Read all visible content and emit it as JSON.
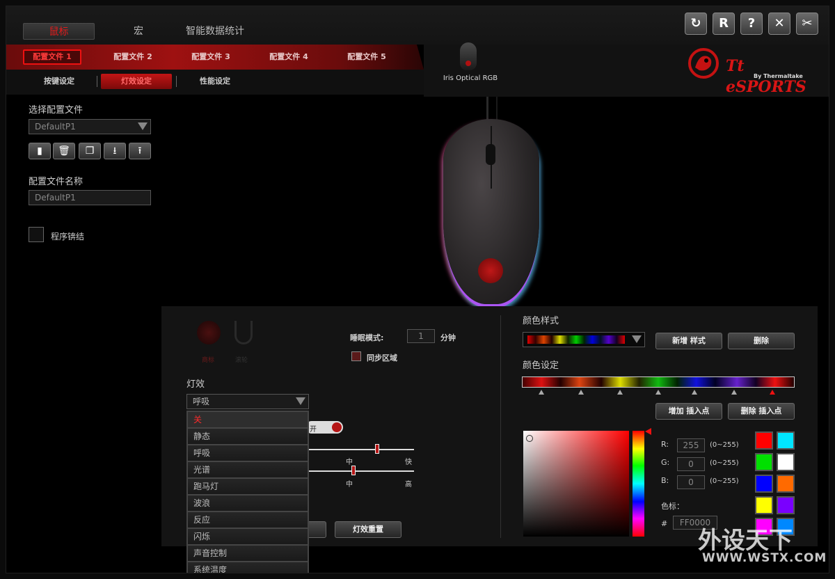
{
  "main_tabs": [
    "鼠标",
    "宏",
    "智能数据统计"
  ],
  "profile_tabs": [
    "配置文件 1",
    "配置文件 2",
    "配置文件 3",
    "配置文件 4",
    "配置文件 5"
  ],
  "sub_tabs": [
    "按键设定",
    "灯效设定",
    "性能设定"
  ],
  "window_buttons": [
    {
      "icon": "refresh-icon",
      "glyph": "↻"
    },
    {
      "icon": "reset-icon",
      "glyph": "R"
    },
    {
      "icon": "help-icon",
      "glyph": "?"
    },
    {
      "icon": "close-icon",
      "glyph": "✕"
    },
    {
      "icon": "tools-icon",
      "glyph": "✂"
    }
  ],
  "device": {
    "name": "Iris Optical RGB"
  },
  "brand": {
    "name": "Tt eSPORTS",
    "sub": "By Thermaltake"
  },
  "left": {
    "select_profile_label": "选择配置文件",
    "select_profile_value": "DefaultP1",
    "profile_name_label": "配置文件名称",
    "profile_name_value": "DefaultP1",
    "program_link_label": "程序锛结"
  },
  "lighting": {
    "zone_logo": "商标",
    "zone_scroll": "滚轮",
    "sleep_label": "睡眠模式:",
    "sleep_value": "1",
    "sleep_unit": "分钟",
    "sync_label": "同步区域",
    "effect_label": "灯效",
    "effect_value": "呼吸",
    "effect_options": [
      "关",
      "静态",
      "呼吸",
      "光谱",
      "跑马灯",
      "波浪",
      "反应",
      "闪烁",
      "声音控制",
      "系统温度"
    ],
    "toggle_partial": "开",
    "slider1_labels": [
      "中",
      "快"
    ],
    "slider2_labels": [
      "中",
      "高"
    ],
    "reset_button": "灯效重置"
  },
  "color": {
    "style_label": "颜色样式",
    "new_style_button": "新增 样式",
    "delete_button": "删除",
    "setting_label": "颜色设定",
    "add_point_button": "增加 插入点",
    "delete_point_button": "删除 插入点",
    "r_label": "R:",
    "r_value": "255",
    "g_label": "G:",
    "g_value": "0",
    "b_label": "B:",
    "b_value": "0",
    "range": "(0~255)",
    "hex_label": "色标：",
    "hash": "#",
    "hex_value": "FF0000",
    "swatches": [
      "#ff0000",
      "#00e5ff",
      "#00e000",
      "#ffffff",
      "#0000ff",
      "#ff6a00",
      "#ffff00",
      "#7a00ff",
      "#ff00ff",
      "#0088ff"
    ]
  },
  "watermark": {
    "cn": "外设天下",
    "url": "WWW.WSTX.COM"
  }
}
